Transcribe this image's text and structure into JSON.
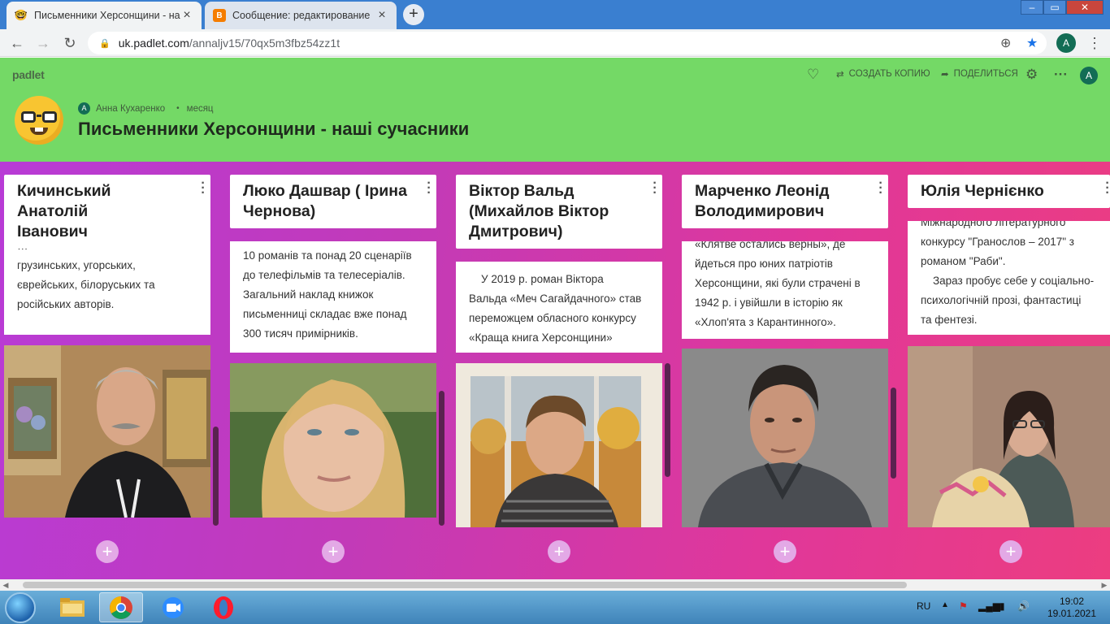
{
  "browser": {
    "tabs": [
      {
        "title": "Письменники Херсонщини - на",
        "icon": "nerd-emoji-icon",
        "active": true
      },
      {
        "title": "Сообщение: редактирование",
        "icon": "blogger-icon",
        "active": false
      }
    ],
    "url_domain": "uk.padlet.com",
    "url_path": "/annaljv15/70qx5m3fbz54zz1t",
    "profile_initial": "A"
  },
  "padlet": {
    "logo": "padlet",
    "author": "Анна Кухаренко",
    "author_initial": "A",
    "time": "месяц",
    "title": "Письменники Херсонщини - наші сучасники",
    "actions": {
      "copy": "СОЗДАТЬ КОПИЮ",
      "share": "ПОДЕЛИТЬСЯ"
    },
    "user_initial": "A"
  },
  "columns": [
    {
      "heading": [
        "Кичинський Анатолій",
        "Іванович"
      ],
      "text": [
        "грузинських, угорських,",
        "єврейських, білоруських та",
        "російських авторів."
      ],
      "top_partial": "…",
      "photo": "author-photo-kychynskyi"
    },
    {
      "heading": [
        "Люко Дашвар ( Ірина",
        "Чернова)"
      ],
      "text": [
        "10 романів та понад 20 сценаріїв",
        "до телефільмів та телесеріалів.",
        "Загальний наклад книжок",
        "письменниці складає вже понад",
        "300 тисяч примірників."
      ],
      "photo": "author-photo-dashvar"
    },
    {
      "heading": [
        "Віктор Вальд",
        "(Михайлов Віктор",
        "Дмитрович)"
      ],
      "text": [
        "    У 2019 р. роман Віктора",
        "Вальда «Меч Сагайдачного» став",
        "переможцем обласного конкурсу",
        "«Краща книга Херсонщини»"
      ],
      "photo": "author-photo-vald"
    },
    {
      "heading": [
        "Марченко Леонід",
        "Володимирович"
      ],
      "text": [
        "«Клятве остались верны», де",
        "йдеться про юних патріотів",
        "Херсонщини, які були страчені в",
        "1942 р. і увійшли в історію як",
        "«Хлоп'ята з Карантинного»."
      ],
      "photo": "author-photo-marchenko"
    },
    {
      "heading": [
        "Юлія Чернієнко"
      ],
      "text": [
        "Міжнародного літературного",
        "конкурсу \"Гранослов – 2017\" з",
        "романом \"Раби\".",
        "    Зараз пробує себе у соціально-",
        "психологічній прозі, фантастиці",
        "та фентезі."
      ],
      "photo": "author-photo-cherniienko"
    }
  ],
  "taskbar": {
    "lang": "RU",
    "time": "19:02",
    "date": "19.01.2021",
    "apps": [
      "file-explorer-icon",
      "chrome-icon",
      "zoom-icon",
      "opera-icon"
    ]
  },
  "colors": {
    "header_bg": "#74d966",
    "board_start": "#b83bd6",
    "board_end": "#ec3d80",
    "add_button": "#e3a9e6"
  }
}
